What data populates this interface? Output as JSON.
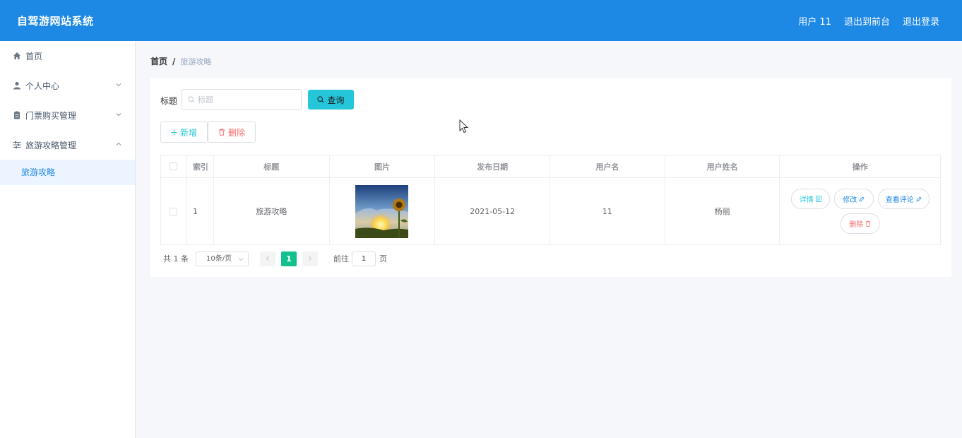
{
  "header": {
    "title": "自驾游网站系统",
    "user": "用户 11",
    "to_front": "退出到前台",
    "logout": "退出登录"
  },
  "sidebar": {
    "items": [
      {
        "label": "首页",
        "icon": "home-icon"
      },
      {
        "label": "个人中心",
        "icon": "user-icon"
      },
      {
        "label": "门票购买管理",
        "icon": "clipboard-icon"
      },
      {
        "label": "旅游攻略管理",
        "icon": "sliders-icon"
      }
    ],
    "active_sub": "旅游攻略"
  },
  "breadcrumb": {
    "home": "首页",
    "separator": "/",
    "current": "旅游攻略"
  },
  "search": {
    "label": "标题",
    "placeholder": "标题",
    "value": "",
    "button": "查询"
  },
  "actions": {
    "add": "新增",
    "delete": "删除"
  },
  "table": {
    "headers": [
      "索引",
      "标题",
      "图片",
      "发布日期",
      "用户名",
      "用户姓名",
      "操作"
    ],
    "rows": [
      {
        "index": "1",
        "title": "旅游攻略",
        "image": "sunflower-sunset-thumbnail",
        "date": "2021-05-12",
        "username": "11",
        "name": "杨丽",
        "ops": {
          "detail": "详情",
          "edit": "修改",
          "comment": "查看评论",
          "remove": "删除"
        }
      }
    ]
  },
  "pagination": {
    "total": "共 1 条",
    "page_size": "10条/页",
    "current_page": "1",
    "goto_label": "前往",
    "goto_value": "1",
    "page_suffix": "页"
  },
  "colors": {
    "header": "#1e88e5",
    "accent": "#26c6da",
    "danger": "#f56c6c",
    "pager_active": "#10c18d"
  }
}
